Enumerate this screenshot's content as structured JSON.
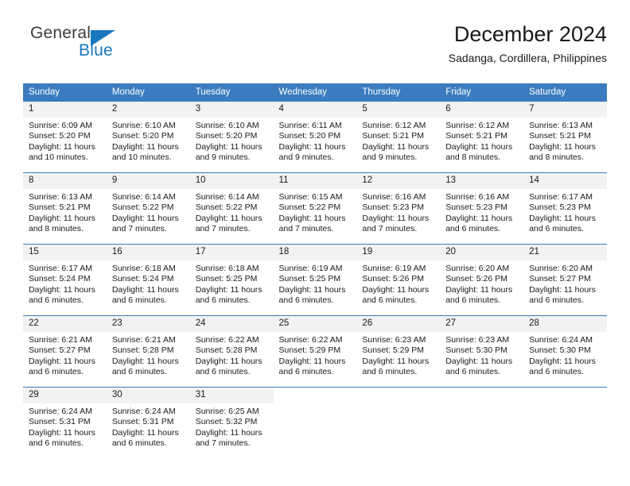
{
  "logo": {
    "word1": "General",
    "word2": "Blue",
    "triangle_color": "#1878be",
    "word1_color": "#3c3c3c",
    "word2_color": "#1878be"
  },
  "header": {
    "title": "December 2024",
    "subtitle": "Sadanga, Cordillera, Philippines"
  },
  "theme": {
    "header_blue": "#3a7cbf",
    "daynum_bg": "#f2f2f2",
    "text": "#1a1a1a"
  },
  "calendar": {
    "weekdays": [
      "Sunday",
      "Monday",
      "Tuesday",
      "Wednesday",
      "Thursday",
      "Friday",
      "Saturday"
    ],
    "weeks": [
      [
        {
          "day": "1",
          "sunrise": "Sunrise: 6:09 AM",
          "sunset": "Sunset: 5:20 PM",
          "daylight1": "Daylight: 11 hours",
          "daylight2": "and 10 minutes."
        },
        {
          "day": "2",
          "sunrise": "Sunrise: 6:10 AM",
          "sunset": "Sunset: 5:20 PM",
          "daylight1": "Daylight: 11 hours",
          "daylight2": "and 10 minutes."
        },
        {
          "day": "3",
          "sunrise": "Sunrise: 6:10 AM",
          "sunset": "Sunset: 5:20 PM",
          "daylight1": "Daylight: 11 hours",
          "daylight2": "and 9 minutes."
        },
        {
          "day": "4",
          "sunrise": "Sunrise: 6:11 AM",
          "sunset": "Sunset: 5:20 PM",
          "daylight1": "Daylight: 11 hours",
          "daylight2": "and 9 minutes."
        },
        {
          "day": "5",
          "sunrise": "Sunrise: 6:12 AM",
          "sunset": "Sunset: 5:21 PM",
          "daylight1": "Daylight: 11 hours",
          "daylight2": "and 9 minutes."
        },
        {
          "day": "6",
          "sunrise": "Sunrise: 6:12 AM",
          "sunset": "Sunset: 5:21 PM",
          "daylight1": "Daylight: 11 hours",
          "daylight2": "and 8 minutes."
        },
        {
          "day": "7",
          "sunrise": "Sunrise: 6:13 AM",
          "sunset": "Sunset: 5:21 PM",
          "daylight1": "Daylight: 11 hours",
          "daylight2": "and 8 minutes."
        }
      ],
      [
        {
          "day": "8",
          "sunrise": "Sunrise: 6:13 AM",
          "sunset": "Sunset: 5:21 PM",
          "daylight1": "Daylight: 11 hours",
          "daylight2": "and 8 minutes."
        },
        {
          "day": "9",
          "sunrise": "Sunrise: 6:14 AM",
          "sunset": "Sunset: 5:22 PM",
          "daylight1": "Daylight: 11 hours",
          "daylight2": "and 7 minutes."
        },
        {
          "day": "10",
          "sunrise": "Sunrise: 6:14 AM",
          "sunset": "Sunset: 5:22 PM",
          "daylight1": "Daylight: 11 hours",
          "daylight2": "and 7 minutes."
        },
        {
          "day": "11",
          "sunrise": "Sunrise: 6:15 AM",
          "sunset": "Sunset: 5:22 PM",
          "daylight1": "Daylight: 11 hours",
          "daylight2": "and 7 minutes."
        },
        {
          "day": "12",
          "sunrise": "Sunrise: 6:16 AM",
          "sunset": "Sunset: 5:23 PM",
          "daylight1": "Daylight: 11 hours",
          "daylight2": "and 7 minutes."
        },
        {
          "day": "13",
          "sunrise": "Sunrise: 6:16 AM",
          "sunset": "Sunset: 5:23 PM",
          "daylight1": "Daylight: 11 hours",
          "daylight2": "and 6 minutes."
        },
        {
          "day": "14",
          "sunrise": "Sunrise: 6:17 AM",
          "sunset": "Sunset: 5:23 PM",
          "daylight1": "Daylight: 11 hours",
          "daylight2": "and 6 minutes."
        }
      ],
      [
        {
          "day": "15",
          "sunrise": "Sunrise: 6:17 AM",
          "sunset": "Sunset: 5:24 PM",
          "daylight1": "Daylight: 11 hours",
          "daylight2": "and 6 minutes."
        },
        {
          "day": "16",
          "sunrise": "Sunrise: 6:18 AM",
          "sunset": "Sunset: 5:24 PM",
          "daylight1": "Daylight: 11 hours",
          "daylight2": "and 6 minutes."
        },
        {
          "day": "17",
          "sunrise": "Sunrise: 6:18 AM",
          "sunset": "Sunset: 5:25 PM",
          "daylight1": "Daylight: 11 hours",
          "daylight2": "and 6 minutes."
        },
        {
          "day": "18",
          "sunrise": "Sunrise: 6:19 AM",
          "sunset": "Sunset: 5:25 PM",
          "daylight1": "Daylight: 11 hours",
          "daylight2": "and 6 minutes."
        },
        {
          "day": "19",
          "sunrise": "Sunrise: 6:19 AM",
          "sunset": "Sunset: 5:26 PM",
          "daylight1": "Daylight: 11 hours",
          "daylight2": "and 6 minutes."
        },
        {
          "day": "20",
          "sunrise": "Sunrise: 6:20 AM",
          "sunset": "Sunset: 5:26 PM",
          "daylight1": "Daylight: 11 hours",
          "daylight2": "and 6 minutes."
        },
        {
          "day": "21",
          "sunrise": "Sunrise: 6:20 AM",
          "sunset": "Sunset: 5:27 PM",
          "daylight1": "Daylight: 11 hours",
          "daylight2": "and 6 minutes."
        }
      ],
      [
        {
          "day": "22",
          "sunrise": "Sunrise: 6:21 AM",
          "sunset": "Sunset: 5:27 PM",
          "daylight1": "Daylight: 11 hours",
          "daylight2": "and 6 minutes."
        },
        {
          "day": "23",
          "sunrise": "Sunrise: 6:21 AM",
          "sunset": "Sunset: 5:28 PM",
          "daylight1": "Daylight: 11 hours",
          "daylight2": "and 6 minutes."
        },
        {
          "day": "24",
          "sunrise": "Sunrise: 6:22 AM",
          "sunset": "Sunset: 5:28 PM",
          "daylight1": "Daylight: 11 hours",
          "daylight2": "and 6 minutes."
        },
        {
          "day": "25",
          "sunrise": "Sunrise: 6:22 AM",
          "sunset": "Sunset: 5:29 PM",
          "daylight1": "Daylight: 11 hours",
          "daylight2": "and 6 minutes."
        },
        {
          "day": "26",
          "sunrise": "Sunrise: 6:23 AM",
          "sunset": "Sunset: 5:29 PM",
          "daylight1": "Daylight: 11 hours",
          "daylight2": "and 6 minutes."
        },
        {
          "day": "27",
          "sunrise": "Sunrise: 6:23 AM",
          "sunset": "Sunset: 5:30 PM",
          "daylight1": "Daylight: 11 hours",
          "daylight2": "and 6 minutes."
        },
        {
          "day": "28",
          "sunrise": "Sunrise: 6:24 AM",
          "sunset": "Sunset: 5:30 PM",
          "daylight1": "Daylight: 11 hours",
          "daylight2": "and 6 minutes."
        }
      ],
      [
        {
          "day": "29",
          "sunrise": "Sunrise: 6:24 AM",
          "sunset": "Sunset: 5:31 PM",
          "daylight1": "Daylight: 11 hours",
          "daylight2": "and 6 minutes."
        },
        {
          "day": "30",
          "sunrise": "Sunrise: 6:24 AM",
          "sunset": "Sunset: 5:31 PM",
          "daylight1": "Daylight: 11 hours",
          "daylight2": "and 6 minutes."
        },
        {
          "day": "31",
          "sunrise": "Sunrise: 6:25 AM",
          "sunset": "Sunset: 5:32 PM",
          "daylight1": "Daylight: 11 hours",
          "daylight2": "and 7 minutes."
        },
        {
          "day": "",
          "sunrise": "",
          "sunset": "",
          "daylight1": "",
          "daylight2": ""
        },
        {
          "day": "",
          "sunrise": "",
          "sunset": "",
          "daylight1": "",
          "daylight2": ""
        },
        {
          "day": "",
          "sunrise": "",
          "sunset": "",
          "daylight1": "",
          "daylight2": ""
        },
        {
          "day": "",
          "sunrise": "",
          "sunset": "",
          "daylight1": "",
          "daylight2": ""
        }
      ]
    ]
  }
}
